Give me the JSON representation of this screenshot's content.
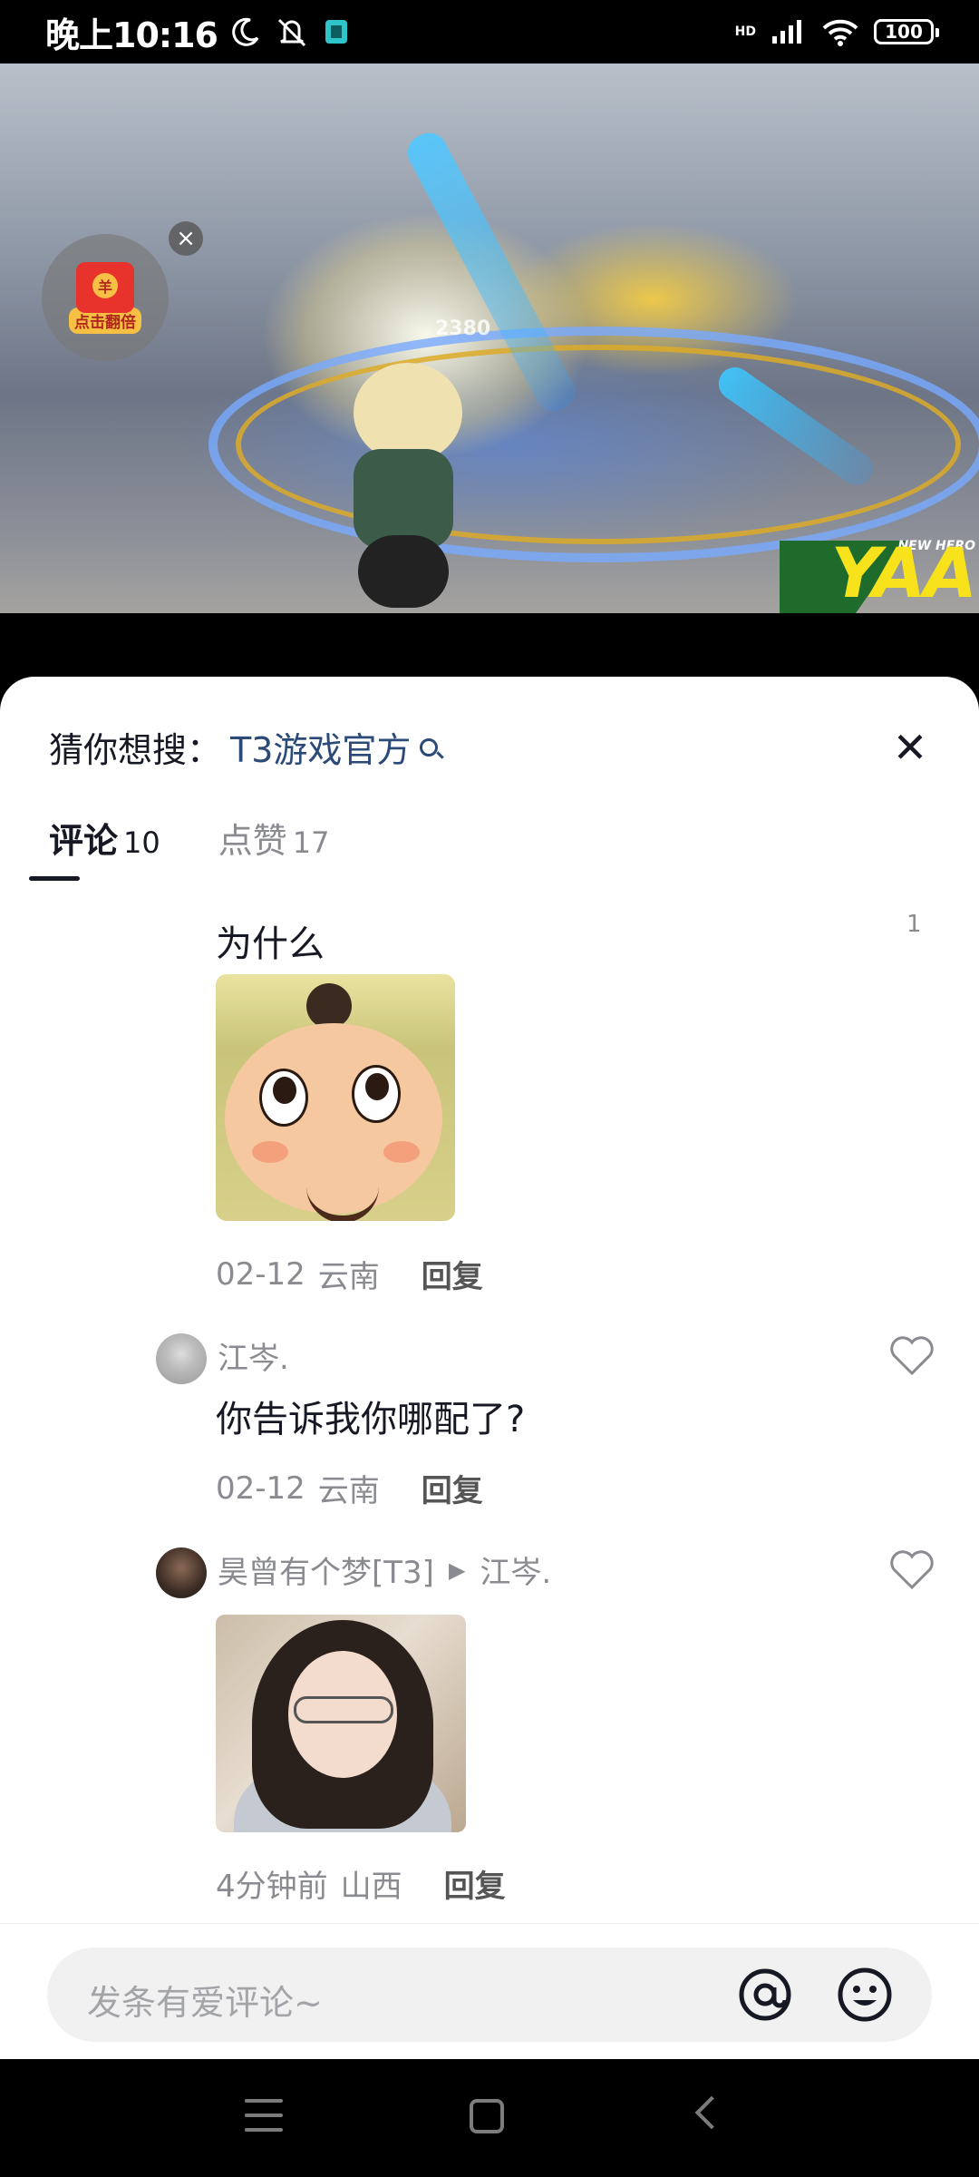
{
  "status_bar": {
    "time": "晚上10:16",
    "network": "HD",
    "battery": "100"
  },
  "video": {
    "damage_number": "2380",
    "badge_text": "YAA",
    "badge_subtext": "NEW HERO"
  },
  "red_packet": {
    "label": "点击翻倍",
    "coin_symbol": "羊",
    "close_icon": "close-icon"
  },
  "comment_sheet": {
    "suggest_prefix": "猜你想搜：",
    "suggest_term": "T3游戏官方",
    "close_icon": "close-icon",
    "tabs": [
      {
        "label": "评论",
        "count": "10",
        "active": true
      },
      {
        "label": "点赞",
        "count": "17",
        "active": false
      }
    ],
    "comments": [
      {
        "text": "为什么",
        "like_count": "1",
        "has_sticker": true,
        "date": "02-12",
        "location": "云南",
        "reply_label": "回复"
      },
      {
        "username": "江岑.",
        "text": "你告诉我你哪配了?",
        "date": "02-12",
        "location": "云南",
        "reply_label": "回复",
        "like_icon": "heart-icon"
      },
      {
        "username": "昊曾有个梦[T3]",
        "reply_to": "江岑.",
        "has_photo": true,
        "date": "4分钟前",
        "location": "山西",
        "reply_label": "回复",
        "like_icon": "heart-icon"
      }
    ]
  },
  "input_bar": {
    "placeholder": "发条有爱评论~",
    "at_icon": "at-icon",
    "emoji_icon": "emoji-icon"
  },
  "colors": {
    "accent_link": "#2c4a78",
    "text_primary": "#161823",
    "text_secondary": "#8a8b91"
  }
}
